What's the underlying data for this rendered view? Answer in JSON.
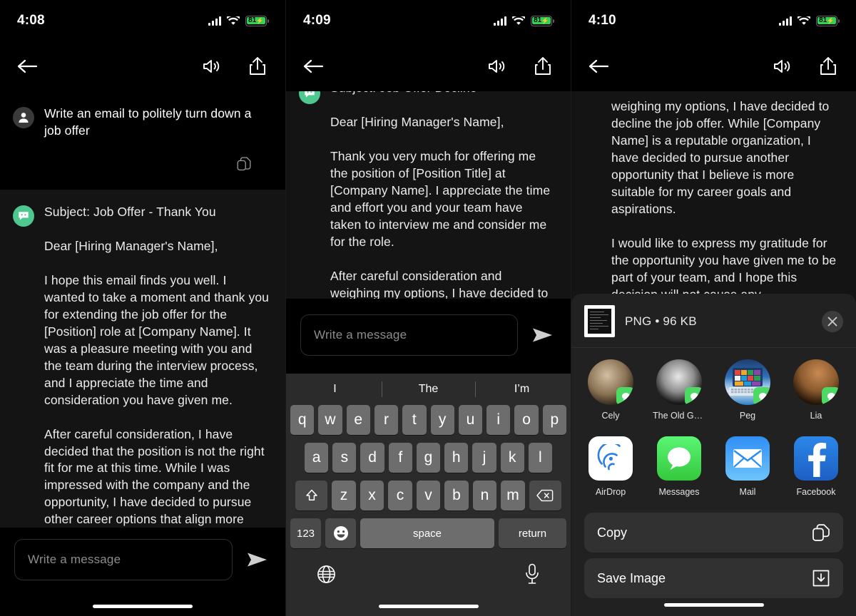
{
  "panels": [
    {
      "status": {
        "time": "4:08",
        "battery_percent": "81",
        "charging": true
      },
      "nav": {
        "back_icon": "arrow-left-icon",
        "speaker_icon": "speaker-icon",
        "share_icon": "share-icon"
      },
      "messages": [
        {
          "role": "user",
          "avatar_icon": "user-avatar-icon",
          "text": "Write an email to politely turn down a job offer",
          "copy_icon": "copy-icon"
        },
        {
          "role": "bot",
          "avatar_icon": "bot-avatar-icon",
          "text": "Subject: Job Offer - Thank You\n\nDear [Hiring Manager's Name],\n\nI hope this email finds you well. I wanted to take a moment and thank you for extending the job offer for the [Position] role at [Company Name]. It was a pleasure meeting with you and the team during the interview process, and I appreciate the time and consideration you have given me.\n\nAfter careful consideration, I have decided that the position is not the right fit for me at this time. While I was impressed with the company and the opportunity, I have decided to pursue other career options that align more closely with my career goals."
        }
      ],
      "composer": {
        "placeholder": "Write a message",
        "value": "",
        "send_icon": "send-icon"
      }
    },
    {
      "status": {
        "time": "4:09",
        "battery_percent": "81",
        "charging": true
      },
      "nav": {
        "back_icon": "arrow-left-icon",
        "speaker_icon": "speaker-icon",
        "share_icon": "share-icon"
      },
      "messages": [
        {
          "role": "bot",
          "avatar_icon": "bot-avatar-icon",
          "text": "Subject: Job Offer Decline\n\nDear [Hiring Manager's Name],\n\nThank you very much for offering me the position of [Position Title] at [Company Name]. I appreciate the time and effort you and your team have taken to interview me and consider me for the role.\n\nAfter careful consideration and weighing my options, I have decided to decline the job offer. While [Company"
        }
      ],
      "composer": {
        "placeholder": "Write a message",
        "value": "",
        "send_icon": "send-icon"
      },
      "keyboard": {
        "predictions": [
          "I",
          "The",
          "I’m"
        ],
        "row1": [
          "q",
          "w",
          "e",
          "r",
          "t",
          "y",
          "u",
          "i",
          "o",
          "p"
        ],
        "row2": [
          "a",
          "s",
          "d",
          "f",
          "g",
          "h",
          "j",
          "k",
          "l"
        ],
        "row3": [
          "z",
          "x",
          "c",
          "v",
          "b",
          "n",
          "m"
        ],
        "shift_icon": "shift-icon",
        "backspace_icon": "backspace-icon",
        "numbers_label": "123",
        "emoji_icon": "emoji-icon",
        "space_label": "space",
        "return_label": "return",
        "globe_icon": "globe-icon",
        "mic_icon": "microphone-icon"
      }
    },
    {
      "status": {
        "time": "4:10",
        "battery_percent": "81",
        "charging": true
      },
      "nav": {
        "back_icon": "arrow-left-icon",
        "speaker_icon": "speaker-icon",
        "share_icon": "share-icon"
      },
      "messages": [
        {
          "role": "bot-continued",
          "text": "weighing my options, I have decided to decline the job offer. While [Company Name] is a reputable organization, I have decided to pursue another opportunity that I believe is more suitable for my career goals and aspirations.\n\nI would like to express my gratitude for the opportunity you have given me to be part of your team, and I hope this decision will not cause any"
        }
      ],
      "share_sheet": {
        "file_info": "PNG • 96 KB",
        "thumbnail_icon": "image-thumbnail-icon",
        "close_icon": "close-icon",
        "contacts": [
          {
            "name": "Cely",
            "badge_icon": "messages-badge-icon"
          },
          {
            "name": "The Old Gang-a...",
            "badge_icon": "messages-badge-icon"
          },
          {
            "name": "Peg",
            "badge_icon": "messages-badge-icon"
          },
          {
            "name": "Lia",
            "badge_icon": "messages-badge-icon"
          },
          {
            "name": "",
            "badge_icon": "messages-badge-icon"
          }
        ],
        "apps": [
          {
            "name": "AirDrop",
            "icon": "airdrop-icon"
          },
          {
            "name": "Messages",
            "icon": "messages-icon"
          },
          {
            "name": "Mail",
            "icon": "mail-icon"
          },
          {
            "name": "Facebook",
            "icon": "facebook-icon"
          },
          {
            "name": "",
            "icon": "zoom-icon"
          }
        ],
        "actions": [
          {
            "label": "Copy",
            "icon": "copy-icon"
          },
          {
            "label": "Save Image",
            "icon": "save-download-icon"
          }
        ]
      }
    }
  ],
  "colors": {
    "background": "#000000",
    "bot_bubble": "#141414",
    "accent_green": "#4ec88f",
    "battery_green": "#32d158",
    "sheet_background": "#212121",
    "key_background": "#6d6d6d"
  }
}
